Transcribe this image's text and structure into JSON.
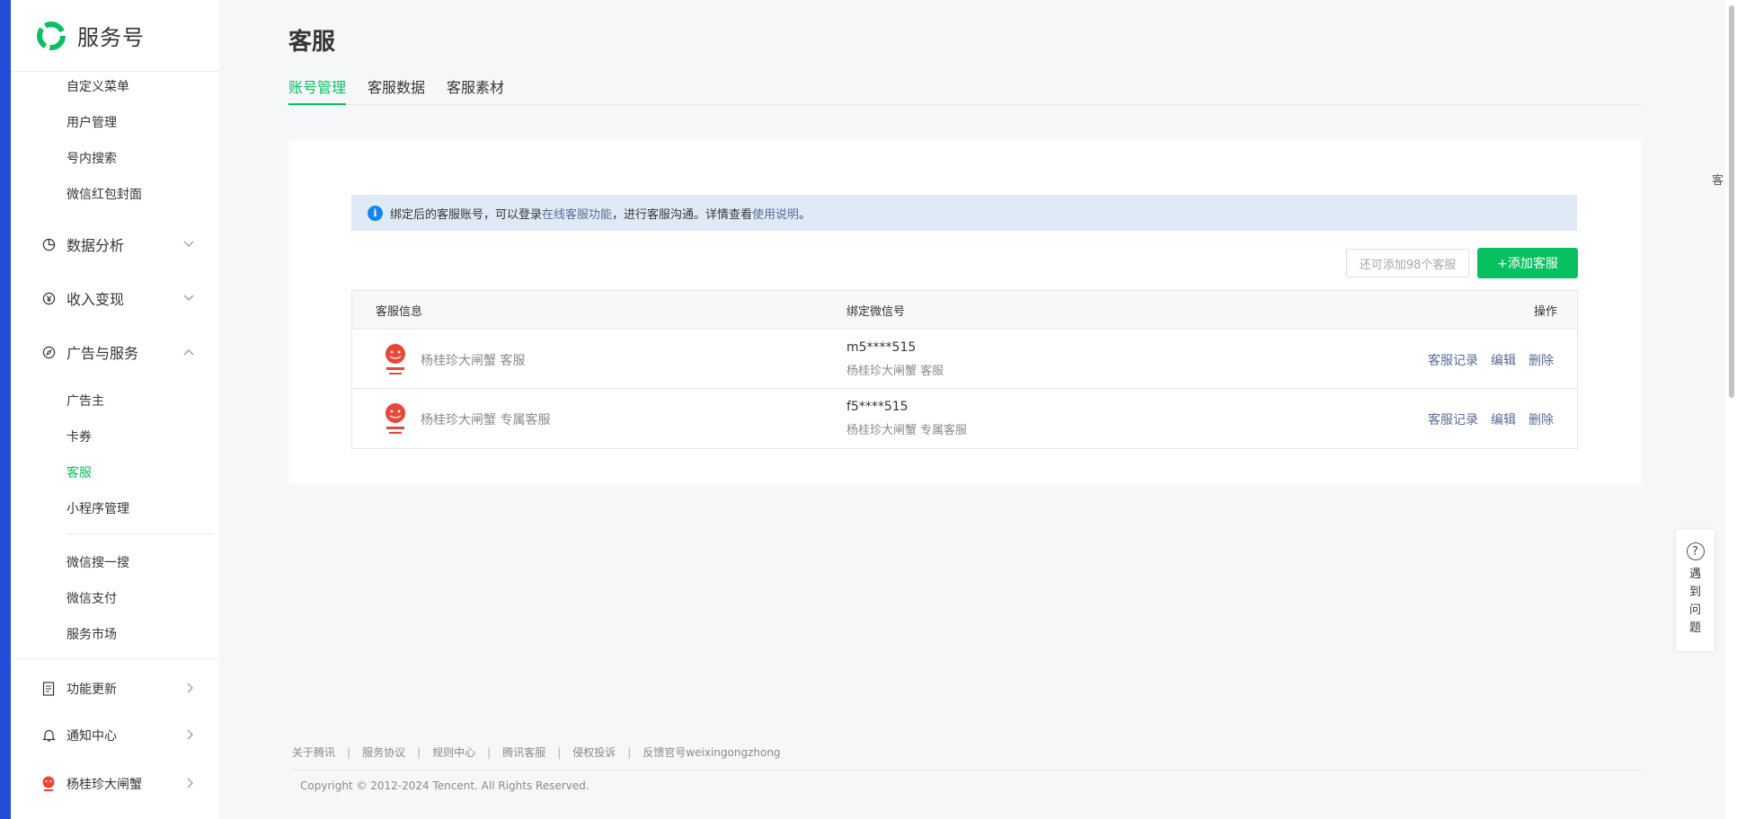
{
  "brand": {
    "name": "服务号"
  },
  "sidebar": {
    "top_items": [
      "自定义菜单",
      "用户管理",
      "号内搜索",
      "微信红包封面"
    ],
    "groups": {
      "data_analysis": "数据分析",
      "income": "收入变现",
      "ads_services": "广告与服务"
    },
    "ads_items": [
      "广告主",
      "卡券",
      "客服",
      "小程序管理"
    ],
    "more_items": [
      "微信搜一搜",
      "微信支付",
      "服务市场"
    ],
    "bottom_items": [
      "功能更新",
      "通知中心",
      "杨桂珍大闸蟹"
    ],
    "active_item": "客服"
  },
  "page": {
    "title": "客服",
    "tabs": [
      "账号管理",
      "客服数据",
      "客服素材"
    ]
  },
  "notice": {
    "prefix": "绑定后的客服账号，可以登录",
    "link1": "在线客服功能",
    "middle": "，进行客服沟通。详情查看",
    "link2": "使用说明",
    "suffix": "。"
  },
  "quota_text": "还可添加98个客服",
  "add_button": "+添加客服",
  "table": {
    "headers": [
      "客服信息",
      "绑定微信号",
      "操作"
    ],
    "rows": [
      {
        "name": "杨桂珍大闸蟹 客服",
        "wechat": "m5****515",
        "nickname": "杨桂珍大闸蟹 客服"
      },
      {
        "name": "杨桂珍大闸蟹 专属客服",
        "wechat": "f5****515",
        "nickname": "杨桂珍大闸蟹 专属客服"
      }
    ],
    "ops": [
      "客服记录",
      "编辑",
      "删除"
    ]
  },
  "footer": {
    "links": [
      "关于腾讯",
      "服务协议",
      "规则中心",
      "腾讯客服",
      "侵权投诉",
      "反馈官号weixingongzhong"
    ],
    "separator": "|",
    "copyright": "Copyright © 2012-2024 Tencent. All Rights Reserved."
  },
  "help": {
    "label": "遇到问题",
    "icon": "?"
  },
  "edge_glyph": "客",
  "colors": {
    "accent": "#07c160",
    "link": "#576b95",
    "notice_bg": "#e0eaf7",
    "info": "#1485ee"
  }
}
